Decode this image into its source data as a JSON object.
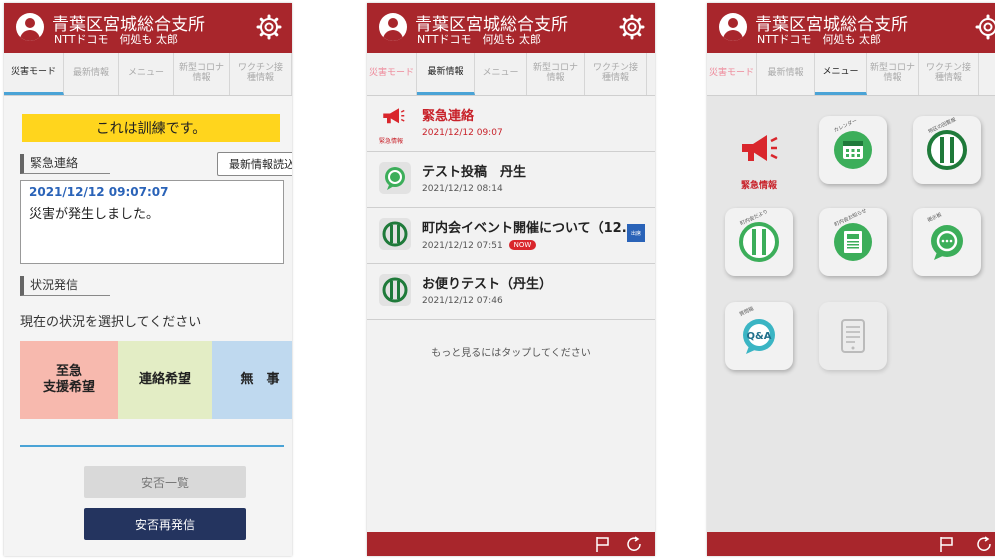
{
  "app": {
    "org_name": "青葉区宮城総合支所",
    "user_line": "NTTドコモ　何処も 太郎"
  },
  "tabs": {
    "disaster_mode": "災害モード",
    "latest": "最新情報",
    "menu": "メニュー",
    "covid": "新型コロナ\n情報",
    "vaccine": "ワクチン接\n種情報"
  },
  "screen1": {
    "drill_banner": "これは訓練です。",
    "emergency_label": "緊急連絡",
    "reload_button": "最新情報読込",
    "message_timestamp": "2021/12/12 09:07:07",
    "message_text": "災害が発生しました。",
    "status_label": "状況発信",
    "prompt": "現在の状況を選択してください",
    "status_options": [
      "至急\n支援希望",
      "連絡希望",
      "無　事"
    ],
    "status_colors": [
      "#f7b9ae",
      "#e3edc5",
      "#bfd9ef"
    ],
    "list_button": "安否一覧",
    "resend_button": "安否再発信"
  },
  "screen2": {
    "items": [
      {
        "title": "緊急連絡",
        "date": "2021/12/12 09:07",
        "icon_caption": "緊急情報",
        "badge": "",
        "icon": "megaphone-icon"
      },
      {
        "title": "テスト投稿　丹生",
        "date": "2021/12/12 08:14",
        "badge": "",
        "icon": "chat-bubble-icon"
      },
      {
        "title": "町内会イベント開催について（12...",
        "date": "2021/12/12 07:51",
        "badge": "NOW",
        "attend": "出席",
        "icon": "community-logo-icon"
      },
      {
        "title": "お便りテスト（丹生）",
        "date": "2021/12/12 07:46",
        "badge": "",
        "icon": "community-logo-icon"
      }
    ],
    "more_text": "もっと見るにはタップしてください"
  },
  "screen3": {
    "emergency_caption": "緊急情報",
    "tiles": [
      "megaphone-icon",
      "calendar-icon",
      "community-logo-icon",
      "community-logo-icon",
      "newsletter-icon",
      "chat-bubble-icon",
      "qa-bubble-icon",
      "tablet-icon"
    ],
    "tile_tags": [
      "",
      "カレンダー",
      "地区の回覧板",
      "町内会だより",
      "町内会お知らせ",
      "掲示板",
      "質問箱",
      ""
    ],
    "qa_label": "Q&A"
  },
  "colors": {
    "brand_red": "#a8262c",
    "drill_yellow": "#ffd51d",
    "accent_blue": "#4aa3d6",
    "navy": "#24345f",
    "icon_green": "#3cae5a"
  }
}
